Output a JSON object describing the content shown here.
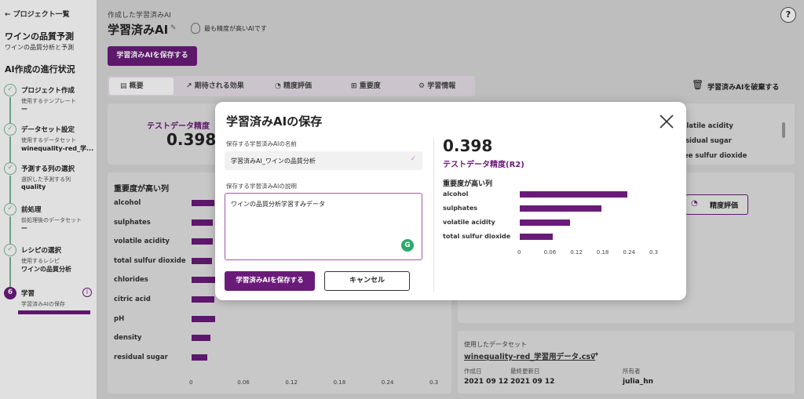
{
  "sidebar": {
    "back_label": "← プロジェクト一覧",
    "project_title": "ワインの品質予測",
    "project_subtitle": "ワインの品質分析と予測",
    "progress_title": "AI作成の進行状況",
    "steps": [
      {
        "title": "プロジェクト作成",
        "caption": "使用するテンプレート",
        "value": "ー"
      },
      {
        "title": "データセット設定",
        "caption": "使用するデータセット",
        "value": "winequality-red_学..."
      },
      {
        "title": "予測する列の選択",
        "caption": "選択した予測する列",
        "value": "quality"
      },
      {
        "title": "前処理",
        "caption": "前処理後のデータセット",
        "value": "ー"
      },
      {
        "title": "レシピの選択",
        "caption": "使用するレシピ",
        "value": "ワインの品質分析"
      },
      {
        "number": "6",
        "title": "学習",
        "caption": "学習済みAIの保存",
        "value": ""
      }
    ]
  },
  "header": {
    "breadcrumb": "作成した学習済みAI",
    "title": "学習済みAI",
    "best_badge": "最も精度が高いAIです",
    "save_button": "学習済みAIを保存する",
    "help": "?"
  },
  "tabs": [
    {
      "label": "概要"
    },
    {
      "label": "期待される効果"
    },
    {
      "label": "精度評価"
    },
    {
      "label": "重要度"
    },
    {
      "label": "学習情報"
    }
  ],
  "discard_button": "学習済みAIを破棄する",
  "accuracy_card": {
    "label": "テストデータ精度",
    "value": "0.398"
  },
  "features_card_right": {
    "items": [
      "volatile acidity",
      "residual sugar",
      "free sulfur dioxide"
    ]
  },
  "accuracy_tab_button": "精度評価",
  "importance_card": {
    "title": "重要度が高い列",
    "ticks": [
      "0",
      "0.06",
      "0.12",
      "0.18",
      "0.24",
      "0.3"
    ]
  },
  "dataset_card": {
    "label": "使用したデータセット",
    "file": "winequality-red_学習用データ.csv",
    "created_label": "作成日",
    "created": "2021 09 12",
    "updated_label": "最終更新日",
    "updated": "2021 09 12",
    "owner_label": "所有者",
    "owner": "julia_hn"
  },
  "modal": {
    "title": "学習済みAIの保存",
    "name_label": "保存する学習済みAIの名前",
    "name_value": "学習済みAI_ワインの品質分析",
    "desc_label": "保存する学習済みAIの説明",
    "desc_value": "ワインの品質分析学習すみデータ",
    "save_button": "学習済みAIを保存する",
    "cancel_button": "キャンセル",
    "score": "0.398",
    "score_label": "テストデータ精度(R2)",
    "chart_title": "重要度が高い列"
  },
  "chart_data": [
    {
      "type": "bar",
      "orientation": "horizontal",
      "title": "重要度が高い列",
      "categories": [
        "alcohol",
        "sulphates",
        "volatile acidity",
        "total sulfur dioxide",
        "chlorides",
        "citric acid",
        "pH",
        "density",
        "residual sugar"
      ],
      "values": [
        0.028,
        0.026,
        0.026,
        0.025,
        0.029,
        0.028,
        0.029,
        0.024,
        0.02
      ],
      "xlim": [
        0,
        0.3
      ],
      "ticks": [
        "0",
        "0.06",
        "0.12",
        "0.18",
        "0.24",
        "0.3"
      ]
    },
    {
      "type": "bar",
      "orientation": "horizontal",
      "title": "重要度が高い列",
      "categories": [
        "alcohol",
        "sulphates",
        "volatile acidity",
        "total sulfur dioxide"
      ],
      "values": [
        0.245,
        0.185,
        0.115,
        0.075
      ],
      "xlim": [
        0,
        0.3
      ],
      "ticks": [
        "0",
        "0.06",
        "0.12",
        "0.18",
        "0.24",
        "0.3"
      ]
    }
  ],
  "colors": {
    "accent": "#6a1b7a",
    "done": "#7db596"
  }
}
